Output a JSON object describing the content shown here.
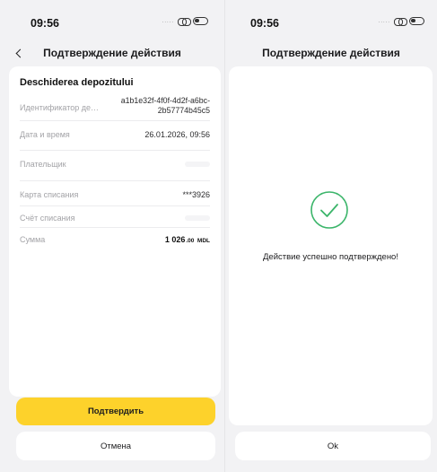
{
  "left_screen": {
    "status_bar": {
      "time": "09:56",
      "dots": "....."
    },
    "nav": {
      "title": "Подтверждение действия"
    },
    "card": {
      "title": "Deschiderea depozitului",
      "rows": [
        {
          "label": "Идентификатор действия",
          "value": "a1b1e32f-4f0f-4d2f-a6bc-2b57774b45c5"
        },
        {
          "label": "Дата и время",
          "value": "26.01.2026, 09:56"
        },
        {
          "label": "Плательщик",
          "value": ""
        },
        {
          "label": "Карта списания",
          "value": "***3926"
        },
        {
          "label": "Счёт списания",
          "value": ""
        },
        {
          "label": "Сумма",
          "amount": "1 026",
          "amount_decimals": ".00",
          "currency": "MDL"
        }
      ]
    },
    "buttons": {
      "confirm": "Подтвердить",
      "cancel": "Отмена"
    },
    "colors": {
      "accent": "#fdd22b",
      "background": "#f2f2f4"
    }
  },
  "right_screen": {
    "status_bar": {
      "time": "09:56",
      "dots": "....."
    },
    "nav": {
      "title": "Подтверждение действия"
    },
    "result": {
      "icon": "check-circle-icon",
      "message": "Действие успешно подтверждено!",
      "icon_color": "#3bb56a"
    },
    "buttons": {
      "ok": "Ok"
    }
  }
}
